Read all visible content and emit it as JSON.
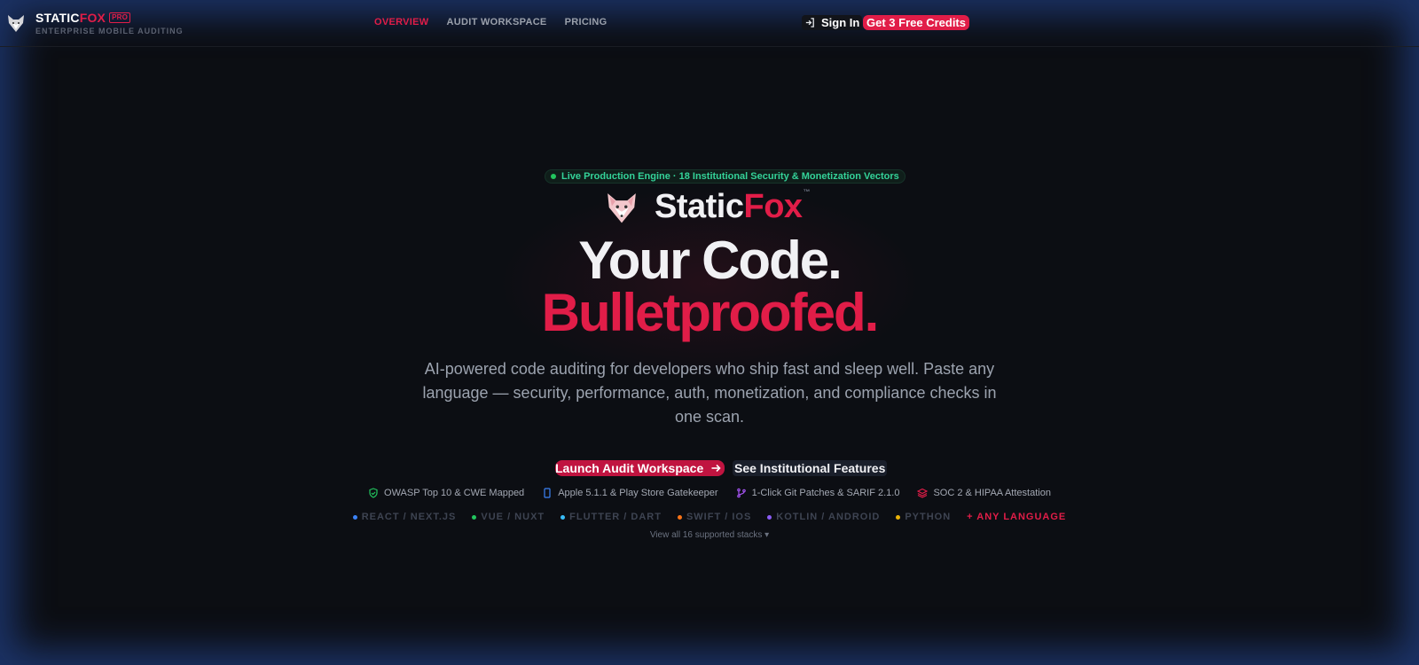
{
  "brand": {
    "name_part1": "STATIC",
    "name_part2": "FOX",
    "badge": "PRO",
    "tagline": "ENTERPRISE MOBILE AUDITING"
  },
  "nav": {
    "links": [
      {
        "label": "OVERVIEW",
        "active": true
      },
      {
        "label": "AUDIT WORKSPACE",
        "active": false
      },
      {
        "label": "PRICING",
        "active": false
      }
    ],
    "signin_label": "Sign In",
    "cta_label": "Get 3 Free Credits"
  },
  "hero": {
    "live_badge": "Live Production Engine · 18 Institutional Security & Monetization Vectors",
    "brand_part1": "Static",
    "brand_part2": "Fox",
    "trademark": "™",
    "headline_1": "Your Code.",
    "headline_2": "Bulletproofed.",
    "lead": "AI-powered code auditing for developers who ship fast and sleep well. Paste any language — security, performance, auth, monetization, and compliance checks in one scan.",
    "primary_button": "Launch Audit Workspace",
    "secondary_button": "See Institutional Features"
  },
  "features": [
    {
      "label": "OWASP Top 10 & CWE Mapped",
      "icon": "shield-check-icon",
      "color": "#22c55e"
    },
    {
      "label": "Apple 5.1.1 & Play Store Gatekeeper",
      "icon": "phone-icon",
      "color": "#3b82f6"
    },
    {
      "label": "1-Click Git Patches & SARIF 2.1.0",
      "icon": "git-branch-icon",
      "color": "#a855f7"
    },
    {
      "label": "SOC 2 & HIPAA Attestation",
      "icon": "layers-icon",
      "color": "#e11d48"
    }
  ],
  "stacks": [
    {
      "label": "REACT / NEXT.JS",
      "color": "#3b82f6"
    },
    {
      "label": "VUE / NUXT",
      "color": "#22c55e"
    },
    {
      "label": "FLUTTER / DART",
      "color": "#38bdf8"
    },
    {
      "label": "SWIFT / IOS",
      "color": "#f97316"
    },
    {
      "label": "KOTLIN / ANDROID",
      "color": "#8b5cf6"
    },
    {
      "label": "PYTHON",
      "color": "#eab308"
    }
  ],
  "any_language": "+ ANY LANGUAGE",
  "view_all": "View all 16 supported stacks ▾",
  "colors": {
    "accent": "#e11d48",
    "background": "#0c0e13",
    "success": "#22c55e"
  }
}
